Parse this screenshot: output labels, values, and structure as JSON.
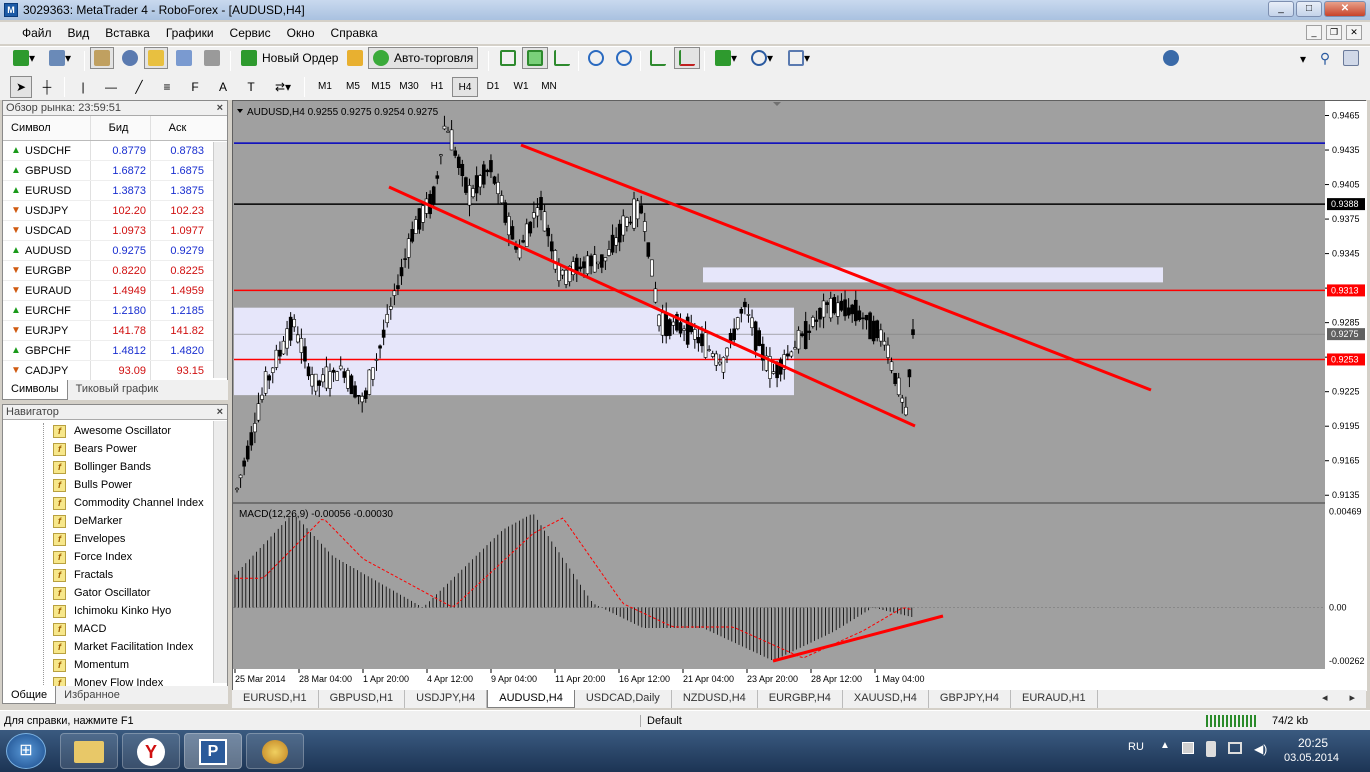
{
  "window": {
    "title": "3029363: MetaTrader 4 - RoboForex - [AUDUSD,H4]",
    "app_icon": "metatrader-icon"
  },
  "menu": [
    "Файл",
    "Вид",
    "Вставка",
    "Графики",
    "Сервис",
    "Окно",
    "Справка"
  ],
  "toolbar": {
    "new_order": "Новый Ордер",
    "autotrading": "Авто-торговля",
    "search_placeholder": ""
  },
  "timeframes": [
    "M1",
    "M5",
    "M15",
    "M30",
    "H1",
    "H4",
    "D1",
    "W1",
    "MN"
  ],
  "active_timeframe": "H4",
  "market_watch": {
    "title": "Обзор рынка: 23:59:51",
    "columns": [
      "Символ",
      "Бид",
      "Аск"
    ],
    "rows": [
      {
        "symbol": "USDCHF",
        "bid": "0.8779",
        "ask": "0.8783",
        "dir": "up"
      },
      {
        "symbol": "GBPUSD",
        "bid": "1.6872",
        "ask": "1.6875",
        "dir": "up"
      },
      {
        "symbol": "EURUSD",
        "bid": "1.3873",
        "ask": "1.3875",
        "dir": "up"
      },
      {
        "symbol": "USDJPY",
        "bid": "102.20",
        "ask": "102.23",
        "dir": "down"
      },
      {
        "symbol": "USDCAD",
        "bid": "1.0973",
        "ask": "1.0977",
        "dir": "down"
      },
      {
        "symbol": "AUDUSD",
        "bid": "0.9275",
        "ask": "0.9279",
        "dir": "up"
      },
      {
        "symbol": "EURGBP",
        "bid": "0.8220",
        "ask": "0.8225",
        "dir": "down"
      },
      {
        "symbol": "EURAUD",
        "bid": "1.4949",
        "ask": "1.4959",
        "dir": "down"
      },
      {
        "symbol": "EURCHF",
        "bid": "1.2180",
        "ask": "1.2185",
        "dir": "up"
      },
      {
        "symbol": "EURJPY",
        "bid": "141.78",
        "ask": "141.82",
        "dir": "down"
      },
      {
        "symbol": "GBPCHF",
        "bid": "1.4812",
        "ask": "1.4820",
        "dir": "up"
      },
      {
        "symbol": "CADJPY",
        "bid": "93.09",
        "ask": "93.15",
        "dir": "down"
      }
    ],
    "tabs": [
      "Символы",
      "Тиковый график"
    ]
  },
  "navigator": {
    "title": "Навигатор",
    "items": [
      "Awesome Oscillator",
      "Bears Power",
      "Bollinger Bands",
      "Bulls Power",
      "Commodity Channel Index",
      "DeMarker",
      "Envelopes",
      "Force Index",
      "Fractals",
      "Gator Oscillator",
      "Ichimoku Kinko Hyo",
      "MACD",
      "Market Facilitation Index",
      "Momentum",
      "Money Flow Index"
    ],
    "tabs": [
      "Общие",
      "Избранное"
    ]
  },
  "chart_data": {
    "type": "candlestick",
    "header": "AUDUSD,H4  0.9255 0.9275 0.9254 0.9275",
    "price_axis": [
      "0.9465",
      "0.9435",
      "0.9405",
      "0.9375",
      "0.9345",
      "0.9315",
      "0.9285",
      "0.9255",
      "0.9225",
      "0.9195",
      "0.9165",
      "0.9135"
    ],
    "ylim": [
      0.913,
      0.9475
    ],
    "markers": [
      {
        "value": "0.9388",
        "color": "#000000"
      },
      {
        "value": "0.9313",
        "color": "#ff0000"
      },
      {
        "value": "0.9275",
        "color": "#606060"
      },
      {
        "value": "0.9253",
        "color": "#ff0000"
      }
    ],
    "hlines": [
      {
        "y": 0.9441,
        "color": "#0000c0"
      },
      {
        "y": 0.9388,
        "color": "#000000"
      },
      {
        "y": 0.9313,
        "color": "#ff0000"
      },
      {
        "y": 0.9253,
        "color": "#ff0000"
      },
      {
        "y": 0.9275,
        "color": "#808080"
      }
    ],
    "time_axis": [
      "25 Mar 2014",
      "28 Mar 04:00",
      "1 Apr 20:00",
      "4 Apr 12:00",
      "9 Apr 04:00",
      "11 Apr 20:00",
      "16 Apr 12:00",
      "21 Apr 04:00",
      "23 Apr 20:00",
      "28 Apr 12:00",
      "1 May 04:00"
    ],
    "macd": {
      "label": "MACD(12,26,9) -0.00056 -0.00030",
      "axis": [
        "0.00469",
        "0.00",
        "-0.00262"
      ],
      "ylim": [
        -0.003,
        0.005
      ]
    }
  },
  "chart_tabs": [
    "EURUSD,H1",
    "GBPUSD,H1",
    "USDJPY,H4",
    "AUDUSD,H4",
    "USDCAD,Daily",
    "NZDUSD,H4",
    "EURGBP,H4",
    "XAUUSD,H4",
    "GBPJPY,H4",
    "EURAUD,H1"
  ],
  "active_chart_tab": "AUDUSD,H4",
  "status": {
    "help": "Для справки, нажмите F1",
    "profile": "Default",
    "traffic": "74/2 kb"
  },
  "taskbar": {
    "lang": "RU",
    "time": "20:25",
    "date": "03.05.2014"
  }
}
